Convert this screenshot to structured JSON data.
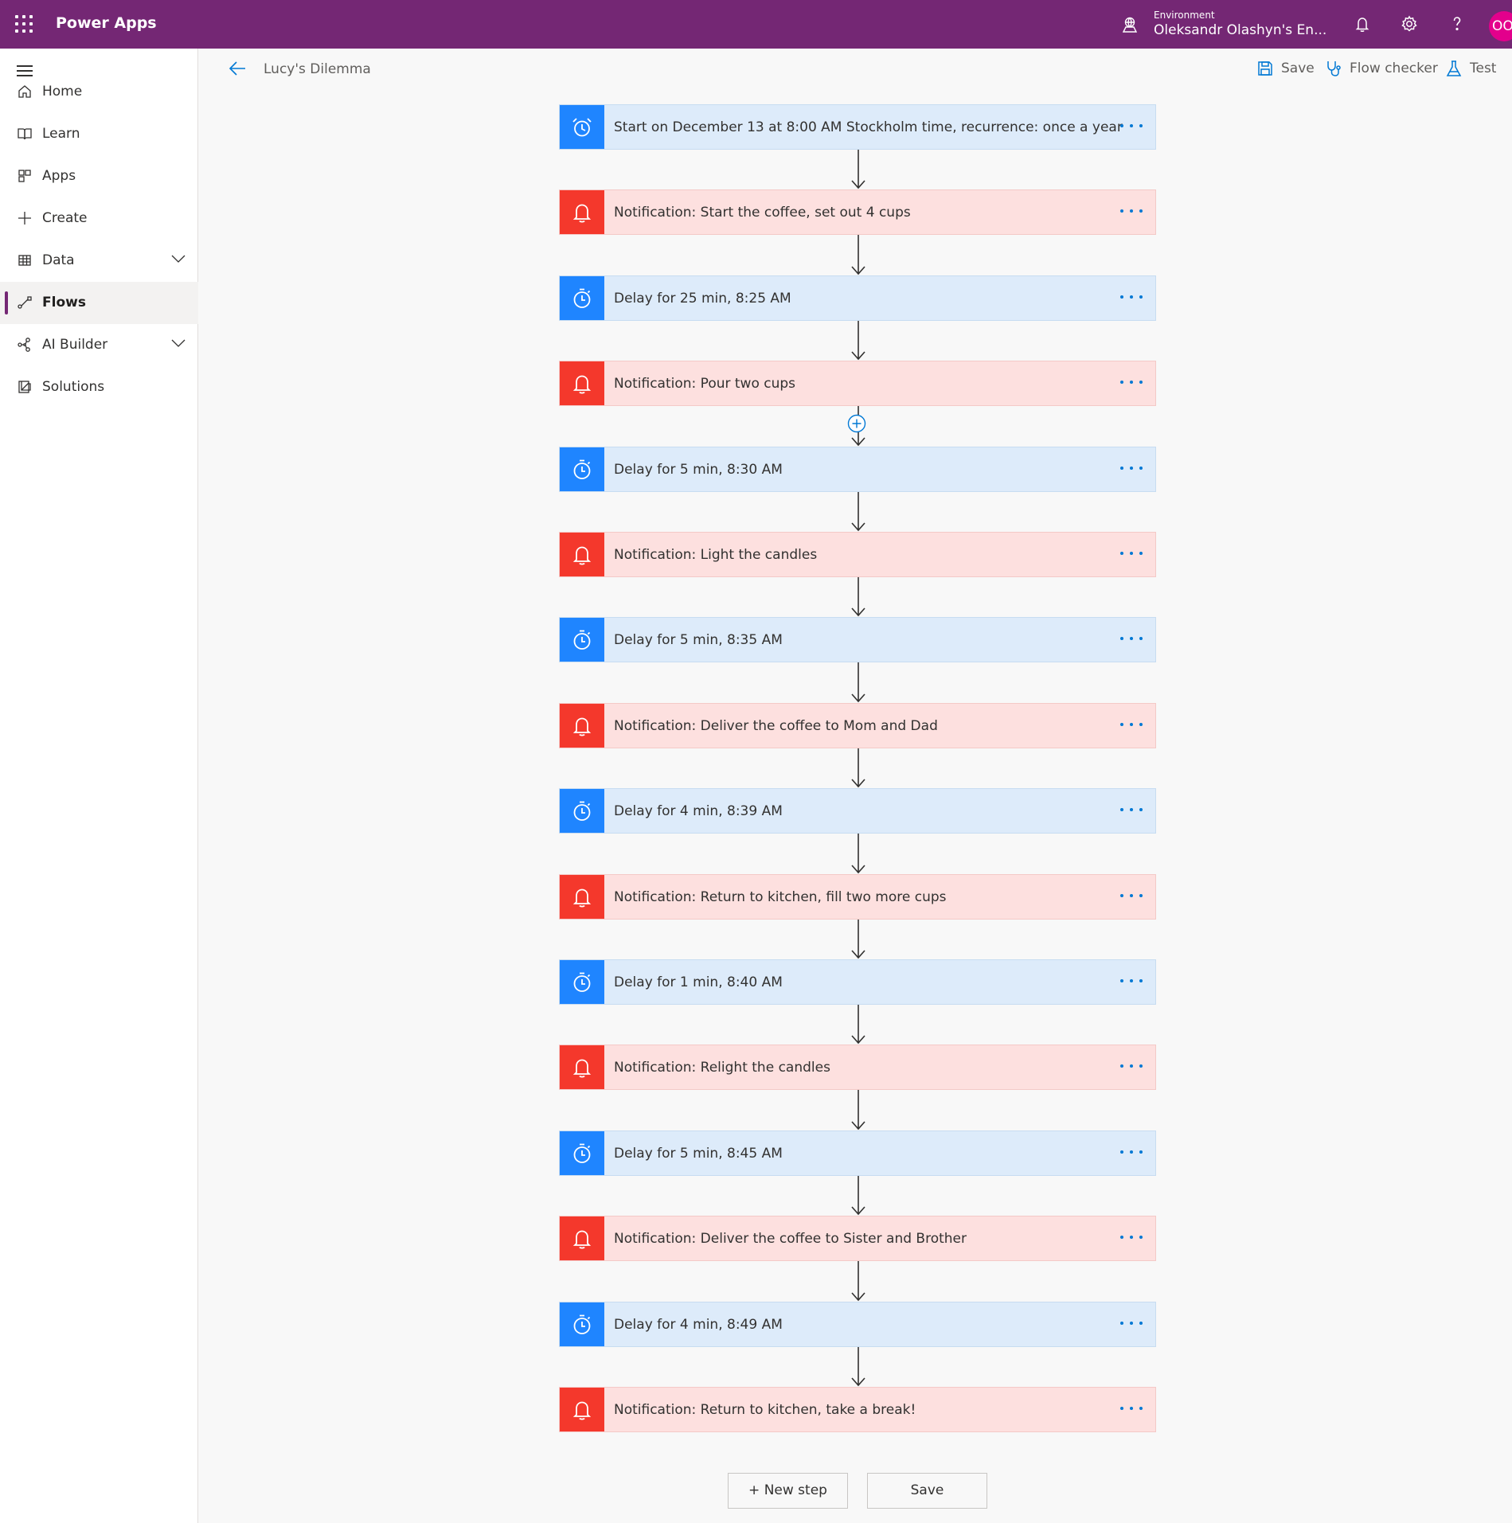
{
  "header": {
    "app_name": "Power Apps",
    "environment_label": "Environment",
    "environment_name": "Oleksandr Olashyn's En...",
    "avatar_initials": "OO",
    "brand_color": "#742774",
    "icons": [
      "waffle-icon",
      "environment-icon",
      "notifications-icon",
      "settings-icon",
      "help-icon"
    ]
  },
  "sidebar": {
    "items": [
      {
        "label": "Home",
        "icon": "home-icon"
      },
      {
        "label": "Learn",
        "icon": "book-icon"
      },
      {
        "label": "Apps",
        "icon": "apps-icon"
      },
      {
        "label": "Create",
        "icon": "plus-icon"
      },
      {
        "label": "Data",
        "icon": "table-icon",
        "expandable": true
      },
      {
        "label": "Flows",
        "icon": "flow-icon",
        "active": true
      },
      {
        "label": "AI Builder",
        "icon": "ai-builder-icon",
        "expandable": true
      },
      {
        "label": "Solutions",
        "icon": "solutions-icon"
      }
    ]
  },
  "command_bar": {
    "flow_name": "Lucy's Dilemma",
    "save_label": "Save",
    "flow_checker_label": "Flow checker",
    "test_label": "Test"
  },
  "steps": [
    {
      "type": "delay",
      "icon": "alarm-clock-icon",
      "label": "Start on December 13 at 8:00 AM Stockholm time, recurrence: once a year"
    },
    {
      "type": "notify",
      "icon": "bell-icon",
      "label": "Notification: Start the coffee, set out 4 cups"
    },
    {
      "type": "delay",
      "icon": "timer-icon",
      "label": "Delay for 25 min, 8:25 AM"
    },
    {
      "type": "notify",
      "icon": "bell-icon",
      "label": "Notification: Pour two cups"
    },
    {
      "type": "delay",
      "icon": "timer-icon",
      "label": "Delay for 5 min, 8:30 AM"
    },
    {
      "type": "notify",
      "icon": "bell-icon",
      "label": "Notification: Light the candles"
    },
    {
      "type": "delay",
      "icon": "timer-icon",
      "label": "Delay for 5 min, 8:35 AM"
    },
    {
      "type": "notify",
      "icon": "bell-icon",
      "label": "Notification: Deliver the coffee to Mom and Dad"
    },
    {
      "type": "delay",
      "icon": "timer-icon",
      "label": "Delay for 4 min, 8:39 AM"
    },
    {
      "type": "notify",
      "icon": "bell-icon",
      "label": "Notification: Return to kitchen, fill two more cups"
    },
    {
      "type": "delay",
      "icon": "timer-icon",
      "label": "Delay for 1 min, 8:40 AM"
    },
    {
      "type": "notify",
      "icon": "bell-icon",
      "label": "Notification: Relight the candles"
    },
    {
      "type": "delay",
      "icon": "timer-icon",
      "label": "Delay for 5 min, 8:45 AM"
    },
    {
      "type": "notify",
      "icon": "bell-icon",
      "label": "Notification: Deliver the coffee to Sister and Brother"
    },
    {
      "type": "delay",
      "icon": "timer-icon",
      "label": "Delay for 4 min, 8:49 AM"
    },
    {
      "type": "notify",
      "icon": "bell-icon",
      "label": "Notification: Return to kitchen, take a break!"
    }
  ],
  "colors": {
    "delay_accent": "#1f85ff",
    "delay_bg": "#ddebfa",
    "notify_accent": "#f4382c",
    "notify_bg": "#fde0df",
    "more_dots": "#0078d4"
  },
  "footer": {
    "new_step_label": "+ New step",
    "save_label": "Save"
  }
}
